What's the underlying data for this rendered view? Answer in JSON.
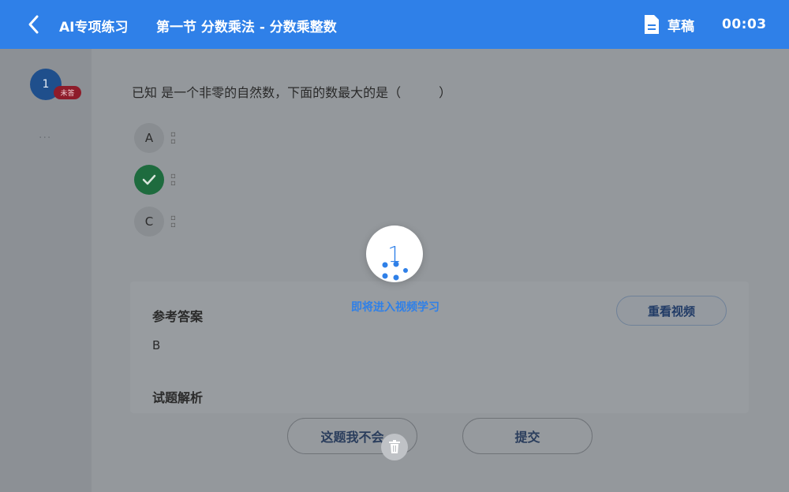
{
  "header": {
    "back_icon": "chevron-left-icon",
    "app_title": "AI专项练习",
    "section_title": "第一节 分数乘法 - 分数乘整数",
    "draft_icon": "document-icon",
    "draft_label": "草稿",
    "timer": "00:03",
    "color": "#2f80e8"
  },
  "sidebar": {
    "question_number": "1",
    "question_badge": "未答",
    "more": "..."
  },
  "question": {
    "text": "已知 是一个非零的自然数，下面的数最大的是（　　　）",
    "options": [
      {
        "letter": "A",
        "state": "default"
      },
      {
        "letter": "",
        "state": "correct",
        "icon": "check-icon"
      },
      {
        "letter": "C",
        "state": "default"
      }
    ]
  },
  "reference": {
    "heading": "参考答案",
    "value": "B",
    "analysis_heading": "试题解析",
    "rewatch_label": "重看视频"
  },
  "actions": {
    "dont_know": "这题我不会",
    "submit": "提交",
    "trash_icon": "trash-icon"
  },
  "overlay": {
    "countdown": "1",
    "message": "即将进入视频学习"
  }
}
